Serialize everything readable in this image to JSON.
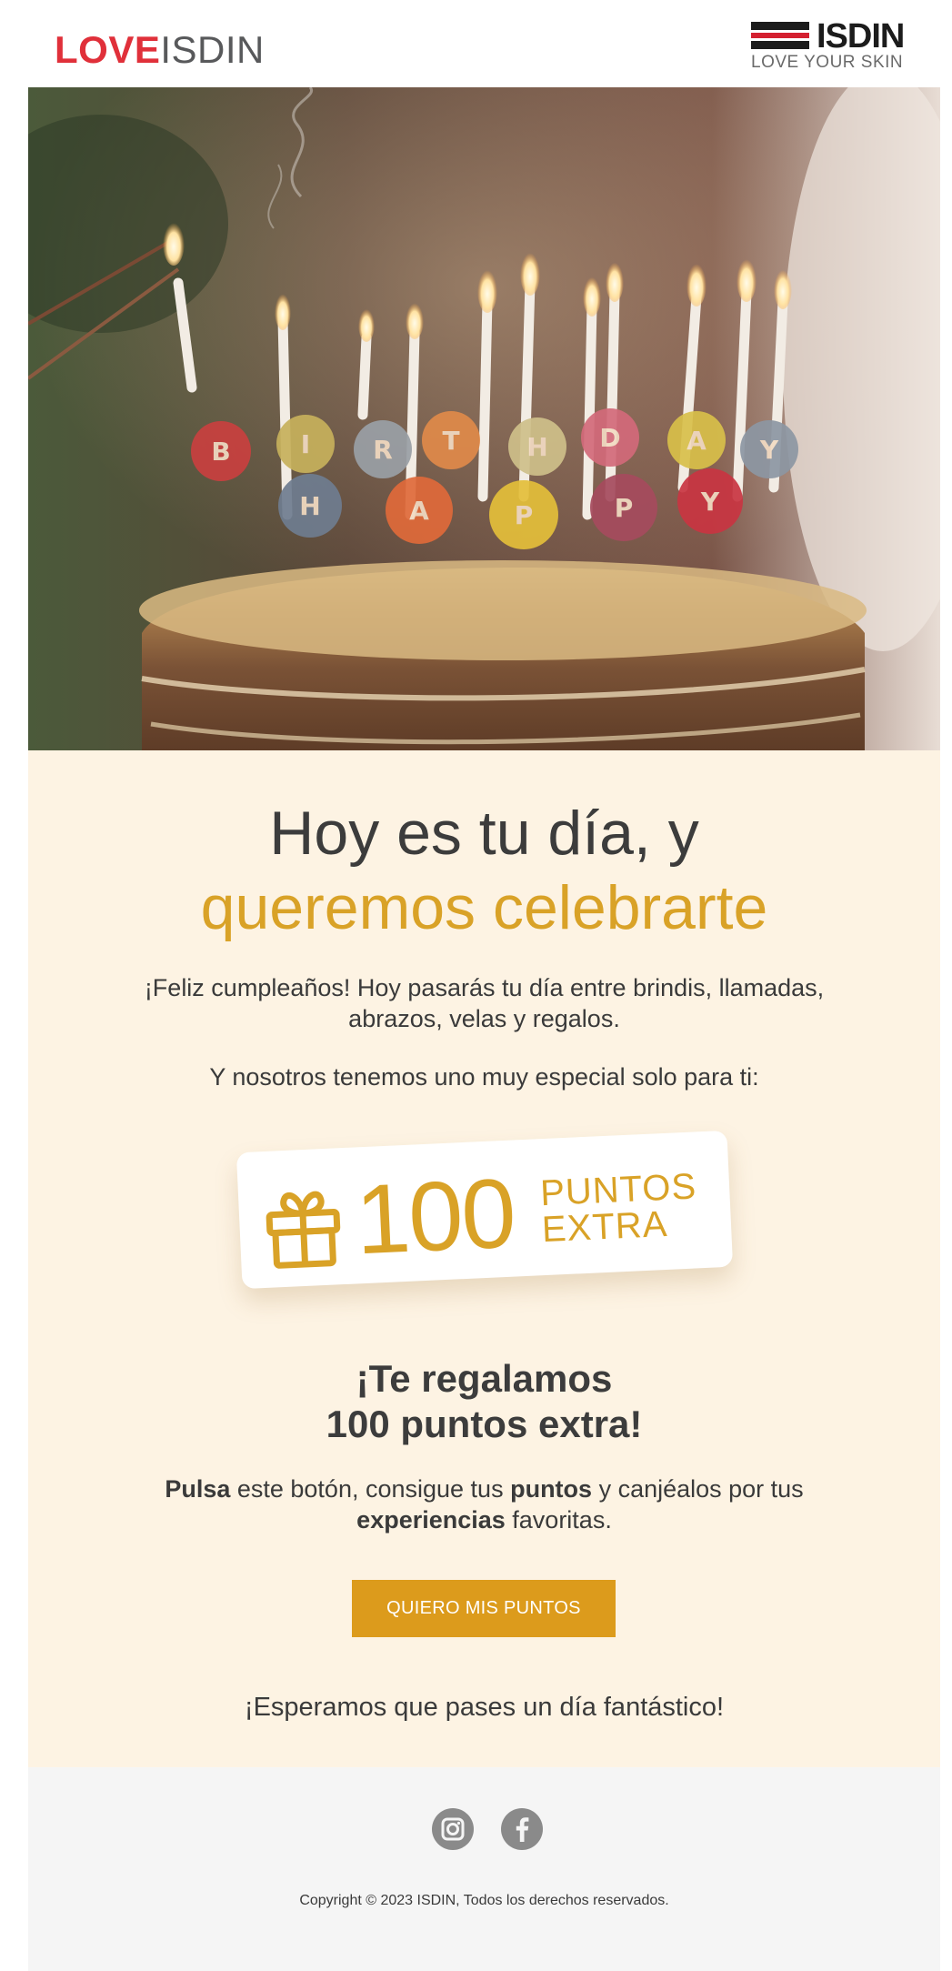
{
  "header": {
    "love_logo_part1": "LOVE",
    "love_logo_part2": "ISDIN",
    "brand_word": "ISDIN",
    "brand_tagline": "LOVE YOUR SKIN"
  },
  "hero": {
    "image_label": "birthday-cake-with-candles",
    "candle_letters": [
      "B",
      "I",
      "R",
      "T",
      "H",
      "D",
      "A",
      "Y",
      "H",
      "A",
      "P",
      "P",
      "Y"
    ]
  },
  "main": {
    "headline_line1": "Hoy es tu día, y",
    "headline_line2": "queremos celebrarte",
    "intro_line1": "¡Feliz cumpleaños! Hoy pasarás tu día entre brindis, llamadas,",
    "intro_line2": "abrazos, velas y regalos.",
    "special_text": "Y nosotros tenemos uno muy especial solo para ti:",
    "points_card": {
      "number": "100",
      "label_line1": "PUNTOS",
      "label_line2": "EXTRA",
      "icon": "gift-icon"
    },
    "subhead_line1": "¡Te regalamos",
    "subhead_line2": "100 puntos extra!",
    "body": {
      "w1": "Pulsa",
      "t1": " este botón, consigue tus ",
      "w2": "puntos",
      "t2": " y canjéalos por tus",
      "w3": "experiencias",
      "t3": " favoritas."
    },
    "cta_label": "QUIERO MIS PUNTOS",
    "closing": "¡Esperamos que pases un día fantástico!"
  },
  "footer": {
    "social": [
      "instagram-icon",
      "facebook-icon"
    ],
    "copyright": "Copyright © 2023 ISDIN, Todos los derechos reservados."
  },
  "colors": {
    "accent_gold": "#d9a227",
    "cta_bg": "#dc9b1c",
    "main_bg": "#fdf3e3",
    "footer_bg": "#f5f5f5",
    "love_red": "#e0303a"
  }
}
